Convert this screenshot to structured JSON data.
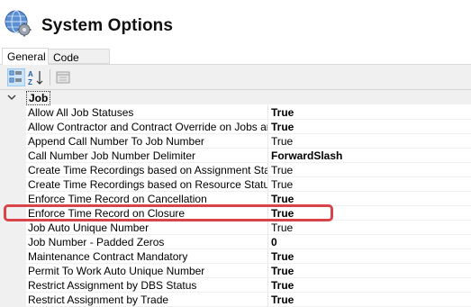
{
  "window": {
    "title": "System Options"
  },
  "tabs": [
    {
      "label": "General",
      "selected": true
    },
    {
      "label": "Code Format",
      "selected": false
    }
  ],
  "toolbar": {
    "categorized_icon": "categorized-view-icon",
    "alphabetical_icon": "alphabetical-sort-icon",
    "property_pages_icon": "property-pages-icon"
  },
  "category": {
    "label": "Job",
    "expanded": true
  },
  "properties": [
    {
      "name": "Allow All Job Statuses",
      "value": "True",
      "bold": true
    },
    {
      "name": "Allow Contractor and Contract Override on Jobs and Ord",
      "value": "True",
      "bold": true
    },
    {
      "name": "Append Call Number To Job Number",
      "value": "True",
      "bold": false
    },
    {
      "name": "Call Number Job Number Delimiter",
      "value": "ForwardSlash",
      "bold": true
    },
    {
      "name": "Create Time Recordings based on Assignment Status",
      "value": "True",
      "bold": false
    },
    {
      "name": "Create Time Recordings based on Resource Status",
      "value": "True",
      "bold": false
    },
    {
      "name": "Enforce Time Record on Cancellation",
      "value": "True",
      "bold": true
    },
    {
      "name": "Enforce Time Record on Closure",
      "value": "True",
      "bold": true
    },
    {
      "name": "Job Auto Unique Number",
      "value": "True",
      "bold": false
    },
    {
      "name": "Job Number - Padded Zeros",
      "value": "0",
      "bold": true
    },
    {
      "name": "Maintenance Contract Mandatory",
      "value": "True",
      "bold": true
    },
    {
      "name": "Permit To Work Auto Unique Number",
      "value": "True",
      "bold": true
    },
    {
      "name": "Restrict Assignment by DBS Status",
      "value": "True",
      "bold": true
    },
    {
      "name": "Restrict Assignment by Trade",
      "value": "True",
      "bold": true
    }
  ],
  "colors": {
    "highlight": "#d9434a",
    "selected_toolbar": "#cce4f7",
    "panel": "#f0f0f0"
  }
}
